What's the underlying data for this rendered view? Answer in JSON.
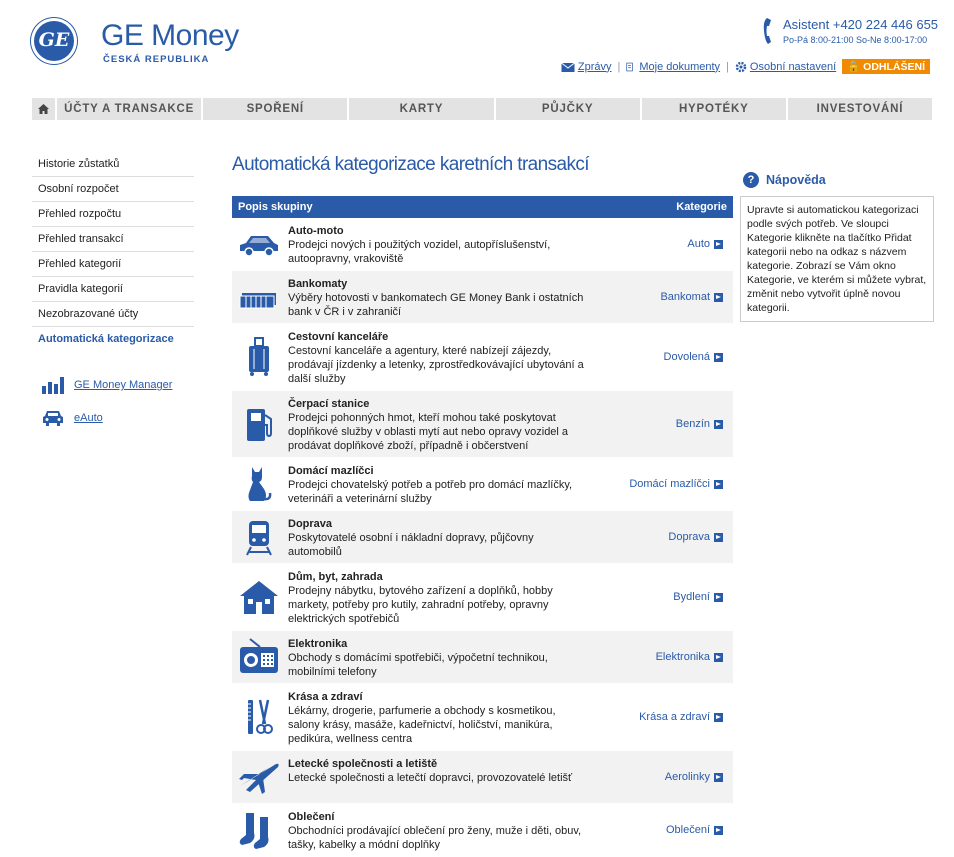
{
  "header": {
    "logo_text": "GE",
    "brand": "GE Money",
    "country": "ČESKÁ REPUBLIKA",
    "assistant": "Asistent +420 224 446 655",
    "hours": "Po-Pá 8:00-21:00 So-Ne 8:00-17:00",
    "links": {
      "messages": "Zprávy",
      "documents": "Moje dokumenty",
      "settings": "Osobní nastavení",
      "logout": "ODHLÁŠENÍ"
    }
  },
  "nav": [
    "ÚČTY A TRANSAKCE",
    "SPOŘENÍ",
    "KARTY",
    "PŮJČKY",
    "HYPOTÉKY",
    "INVESTOVÁNÍ"
  ],
  "sidebar": {
    "items": [
      "Historie zůstatků",
      "Osobní rozpočet",
      "Přehled rozpočtu",
      "Přehled transakcí",
      "Přehled kategorií",
      "Pravidla kategorií",
      "Nezobrazované účty",
      "Automatická kategorizace"
    ],
    "links": [
      "GE Money Manager",
      "eAuto"
    ]
  },
  "main": {
    "title": "Automatická kategorizace karetních transakcí",
    "col_group": "Popis skupiny",
    "col_category": "Kategorie",
    "rows": [
      {
        "icon": "car-icon",
        "name": "Auto-moto",
        "desc": "Prodejci nových i použitých vozidel, autopříslušenství, autoopravny, vrakoviště",
        "cat": "Auto"
      },
      {
        "icon": "banknotes-icon",
        "name": "Bankomaty",
        "desc": "Výběry hotovosti v bankomatech GE Money Bank i ostatních bank v ČR i v zahraničí",
        "cat": "Bankomat"
      },
      {
        "icon": "suitcase-icon",
        "name": "Cestovní kanceláře",
        "desc": "Cestovní kanceláře a agentury, které nabízejí zájezdy, prodávají jízdenky a letenky, zprostředkovávající ubytování a další služby",
        "cat": "Dovolená"
      },
      {
        "icon": "fuel-pump-icon",
        "name": "Čerpací stanice",
        "desc": "Prodejci pohonných hmot, kteří mohou také poskytovat doplňkové služby v oblasti mytí aut nebo opravy vozidel a prodávat doplňkové zboží, případně i občerstvení",
        "cat": "Benzín"
      },
      {
        "icon": "cat-icon",
        "name": "Domácí mazlíčci",
        "desc": "Prodejci chovatelský potřeb a potřeb pro domácí mazlíčky, veterináři a veterinární služby",
        "cat": "Domácí mazlíčci"
      },
      {
        "icon": "train-icon",
        "name": "Doprava",
        "desc": "Poskytovatelé osobní i nákladní dopravy, půjčovny automobilů",
        "cat": "Doprava"
      },
      {
        "icon": "house-icon",
        "name": "Dům, byt, zahrada",
        "desc": "Prodejny nábytku, bytového zařízení a doplňků, hobby markety, potřeby pro kutily, zahradní potřeby, opravny elektrických spotřebičů",
        "cat": "Bydlení"
      },
      {
        "icon": "radio-icon",
        "name": "Elektronika",
        "desc": "Obchody s domácími spotřebiči, výpočetní technikou, mobilními telefony",
        "cat": "Elektronika"
      },
      {
        "icon": "scissors-icon",
        "name": "Krása a zdraví",
        "desc": "Lékárny, drogerie, parfumerie a obchody s kosmetikou, salony krásy, masáže, kadeřnictví, holičství, manikúra, pedikúra, wellness centra",
        "cat": "Krása a zdraví"
      },
      {
        "icon": "airplane-icon",
        "name": "Letecké společnosti a letiště",
        "desc": "Letecké společnosti a letečtí dopravci, provozovatelé letišť",
        "cat": "Aerolinky"
      },
      {
        "icon": "socks-icon",
        "name": "Oblečení",
        "desc": "Obchodníci prodávající oblečení pro ženy, muže i děti, obuv, tašky, kabelky a módní doplňky",
        "cat": "Oblečení"
      }
    ]
  },
  "help": {
    "title": "Nápověda",
    "text": "Upravte si automatickou kategorizaci podle svých potřeb. Ve sloupci Kategorie klikněte na tlačítko Přidat kategorii nebo na odkaz s názvem kategorie. Zobrazí se Vám okno Kategorie, ve kterém si můžete vybrat, změnit nebo vytvořit úplně novou kategorii."
  },
  "colors": {
    "accent": "#2a5ba8",
    "logout": "#f08a00",
    "nav_bg": "#e3e3e3"
  }
}
